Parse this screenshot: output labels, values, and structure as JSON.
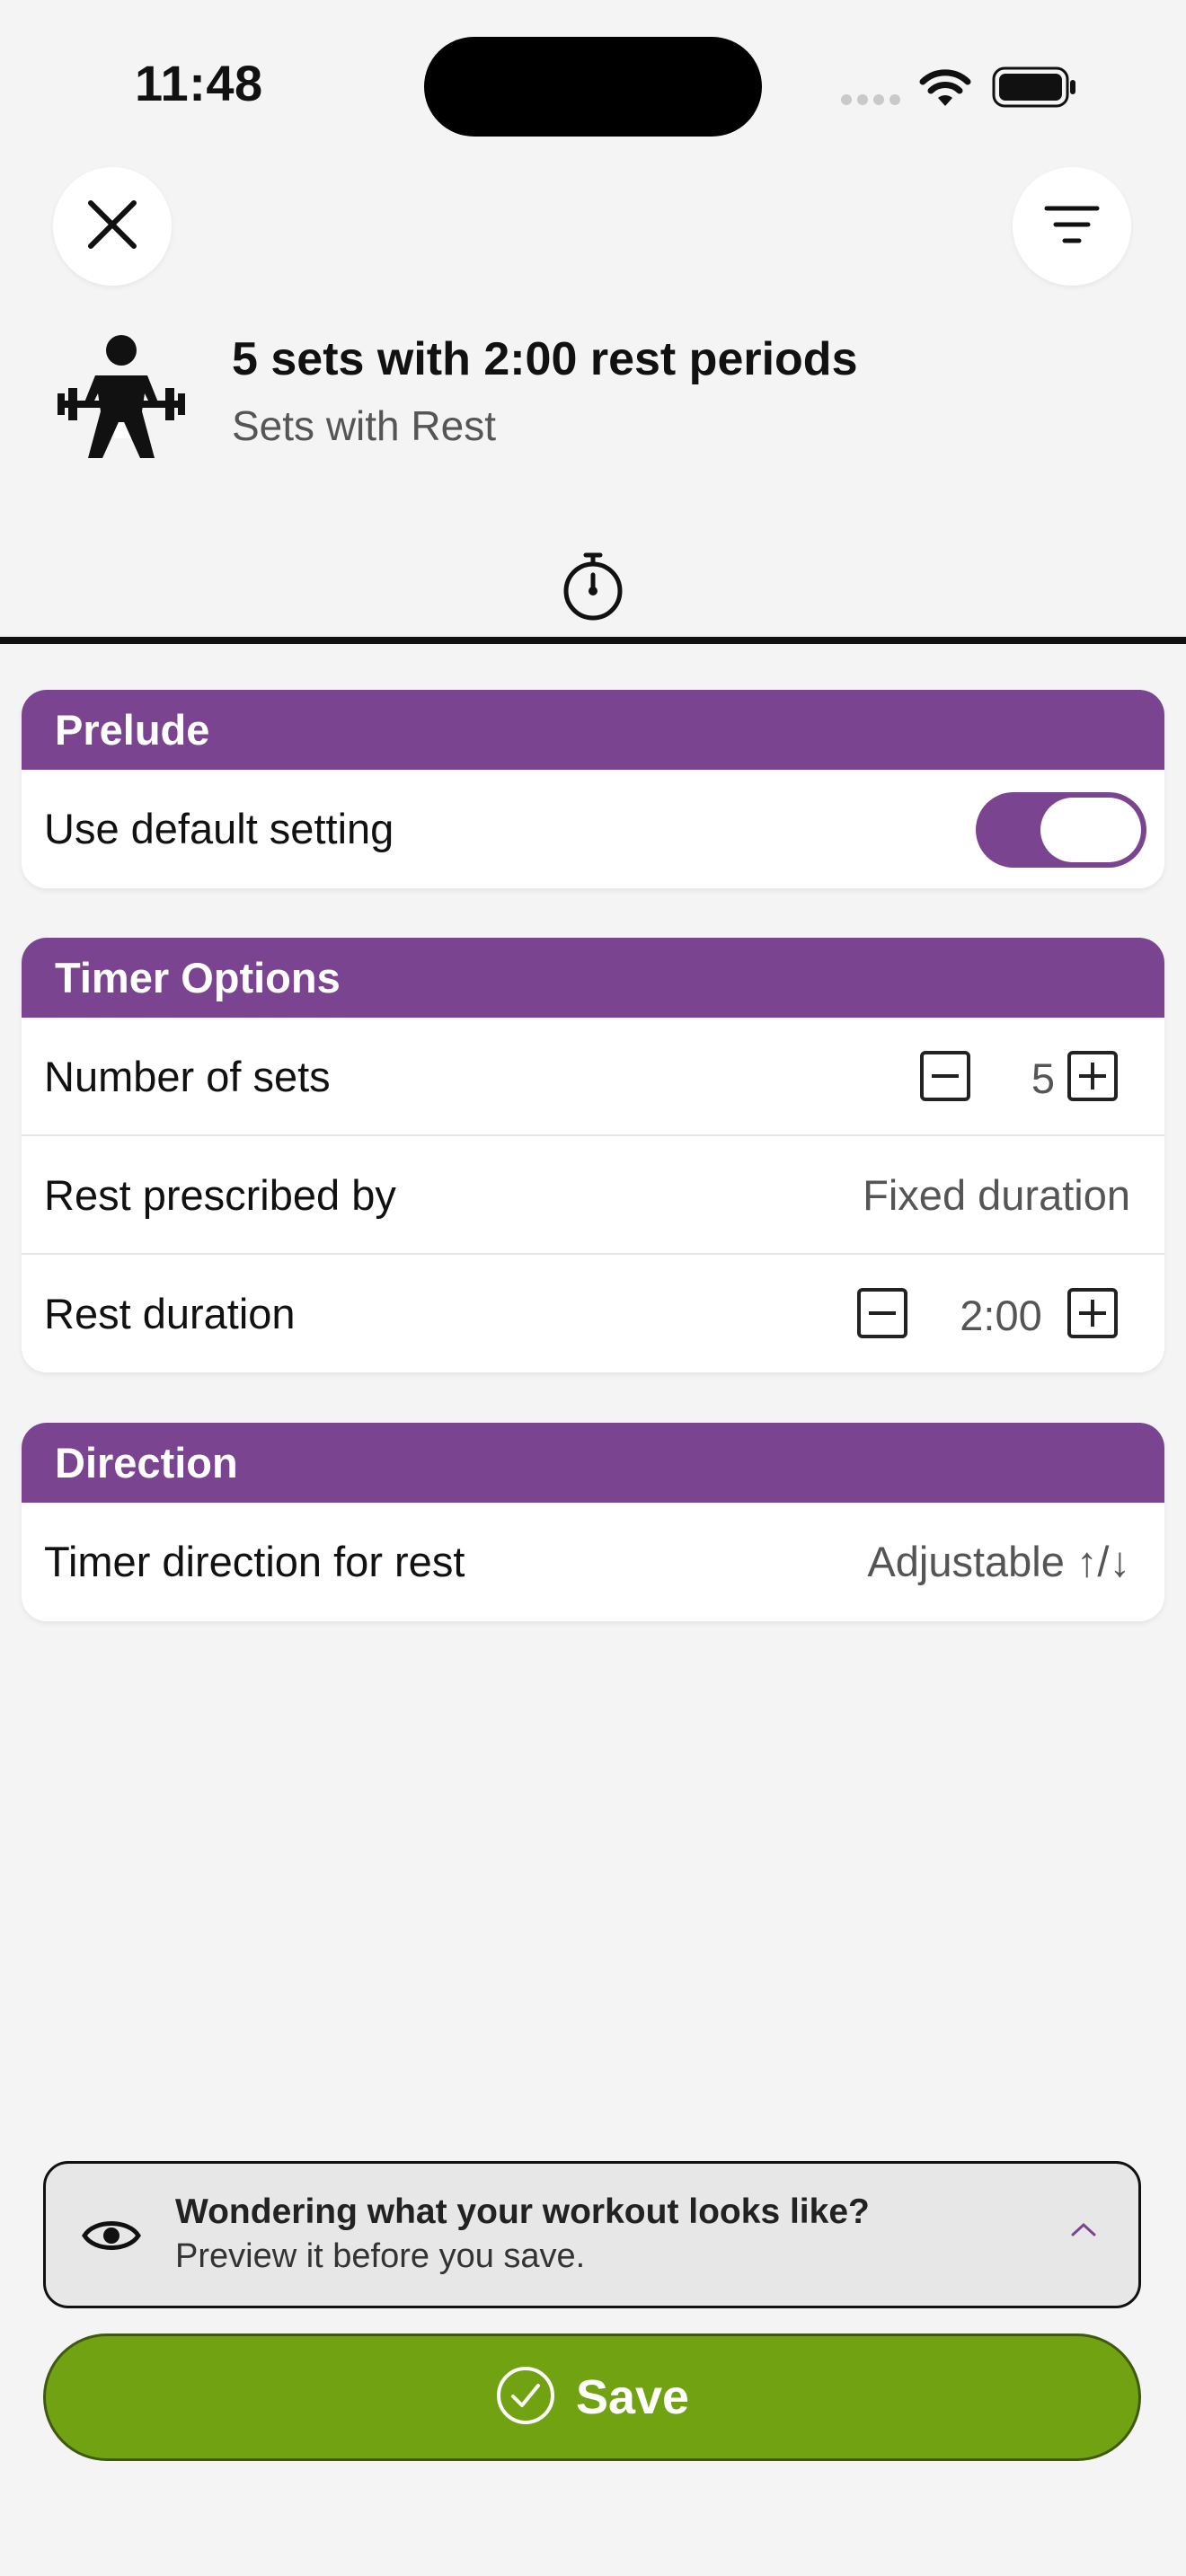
{
  "status_bar": {
    "time": "11:48"
  },
  "header": {
    "title": "5 sets with 2:00 rest periods",
    "subtitle": "Sets with Rest"
  },
  "sections": {
    "prelude": {
      "title": "Prelude",
      "use_default_label": "Use default setting",
      "use_default_on": true
    },
    "timer_options": {
      "title": "Timer Options",
      "sets_label": "Number of sets",
      "sets_value": "5",
      "rest_by_label": "Rest prescribed by",
      "rest_by_value": "Fixed duration",
      "rest_duration_label": "Rest duration",
      "rest_duration_value": "2:00"
    },
    "direction": {
      "title": "Direction",
      "rest_direction_label": "Timer direction for rest",
      "rest_direction_value": "Adjustable ↑/↓"
    }
  },
  "preview": {
    "title": "Wondering what your workout looks like?",
    "subtitle": "Preview it before you save."
  },
  "save": {
    "label": "Save"
  },
  "colors": {
    "accent": "#7b4490",
    "save_green": "#71a211",
    "background": "#f4f4f4"
  },
  "icons": [
    "close-icon",
    "filter-icon",
    "weightlift-icon",
    "stopwatch-icon",
    "minus-icon",
    "plus-icon",
    "eye-icon",
    "chevron-up-icon",
    "check-circle-icon",
    "wifi-icon",
    "battery-icon"
  ]
}
